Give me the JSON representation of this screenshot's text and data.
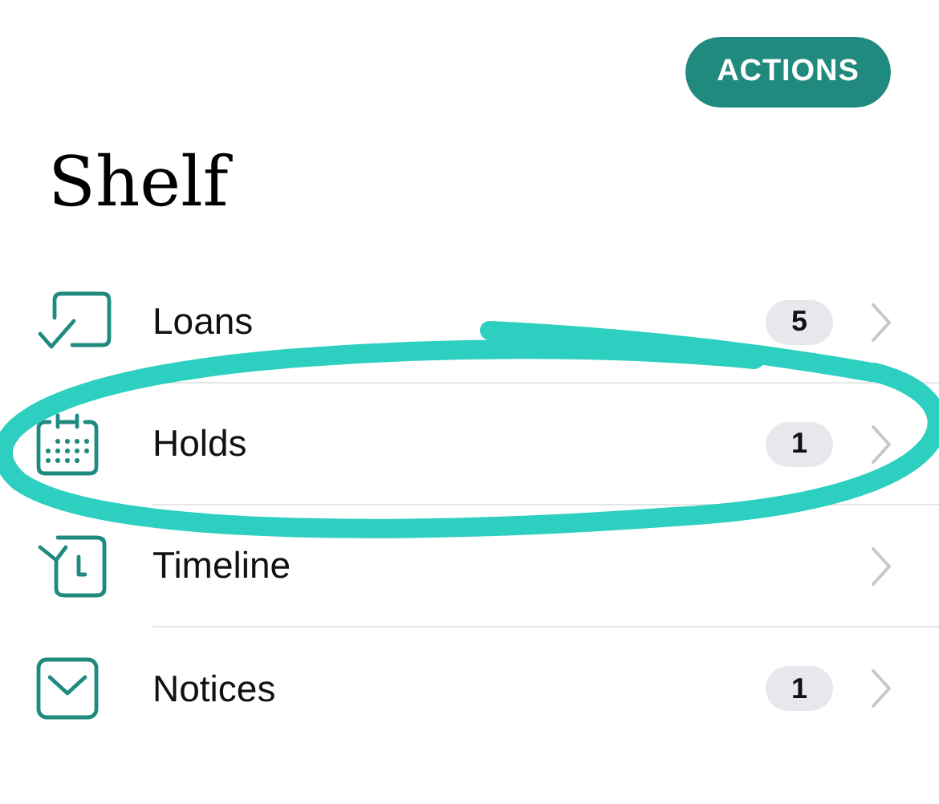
{
  "header": {
    "action_button": "ACTIONS",
    "title": "Shelf"
  },
  "items": [
    {
      "label": "Loans",
      "count": "5"
    },
    {
      "label": "Holds",
      "count": "1"
    },
    {
      "label": "Timeline"
    },
    {
      "label": "Notices",
      "count": "1"
    }
  ]
}
